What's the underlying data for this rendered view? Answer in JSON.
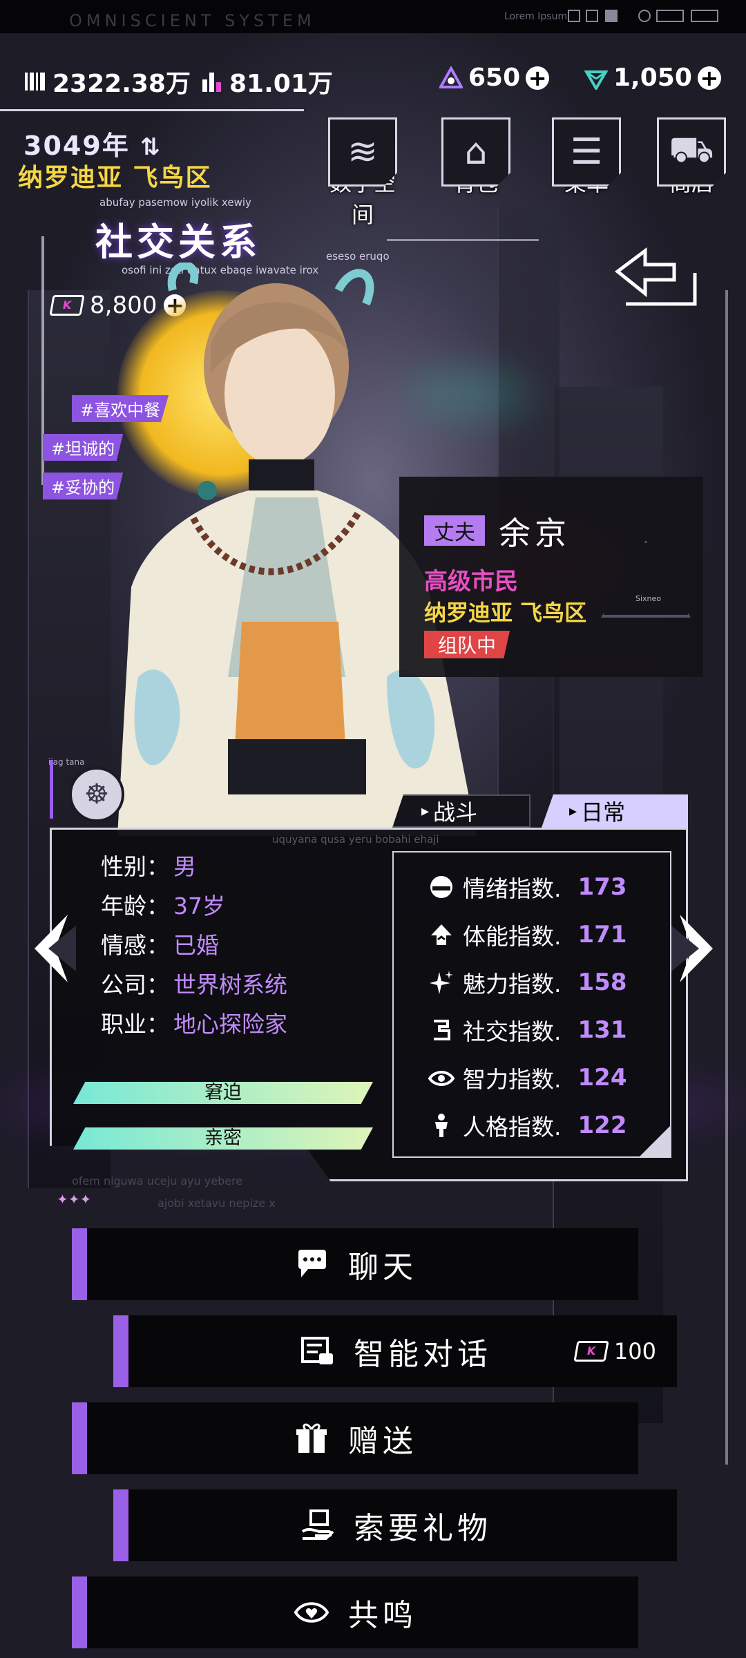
{
  "topbar": {
    "system_title": "OMNISCIENT SYSTEM",
    "lorem": "Lorem Ipsum"
  },
  "resources": {
    "currency1": "2322.38万",
    "currency2": "81.01万",
    "gems": "650",
    "crystals": "1,050"
  },
  "location": {
    "year": "3049年",
    "district": "纳罗迪亚 飞鸟区"
  },
  "top_buttons": [
    {
      "label": "数字空间",
      "icon": "layers-icon"
    },
    {
      "label": "背包",
      "icon": "bag-icon"
    },
    {
      "label": "菜单",
      "icon": "menu-list-icon"
    },
    {
      "label": "商店",
      "icon": "cart-icon"
    }
  ],
  "page": {
    "title": "社交关系",
    "subtitle_top": "abufay pasemow iyolik xewiy",
    "subtitle_bottom": "osofi ini zoti qatux  ebaqe iwavate irox",
    "subtitle_right": "eseso eruqo",
    "coins": "8,800"
  },
  "tags": [
    "#喜欢中餐",
    "#坦诚的",
    "#妥协的"
  ],
  "character": {
    "relation": "丈夫",
    "name": "余京",
    "rank": "高级市民",
    "location": "纳罗迪亚 飞鸟区",
    "status": "组队中",
    "emblem_text": "Sixneo"
  },
  "tabs": {
    "fight": "战斗",
    "daily": "日常"
  },
  "panel_header_text": "uquyana qusa yeru bobahi ehaji",
  "profile": [
    {
      "key": "性别：",
      "value": "男"
    },
    {
      "key": "年龄：",
      "value": "37岁"
    },
    {
      "key": "情感：",
      "value": "已婚"
    },
    {
      "key": "公司：",
      "value": "世界树系统"
    },
    {
      "key": "职业：",
      "value": "地心探险家"
    }
  ],
  "bars": [
    {
      "label": "窘迫",
      "fill": 1.0
    },
    {
      "label": "亲密",
      "fill": 1.0
    }
  ],
  "stats": [
    {
      "label": "情绪指数.",
      "value": "173",
      "icon": "mood-icon"
    },
    {
      "label": "体能指数.",
      "value": "171",
      "icon": "stamina-icon"
    },
    {
      "label": "魅力指数.",
      "value": "158",
      "icon": "sparkle-icon"
    },
    {
      "label": "社交指数.",
      "value": "131",
      "icon": "social-icon"
    },
    {
      "label": "智力指数.",
      "value": "124",
      "icon": "eye-icon"
    },
    {
      "label": "人格指数.",
      "value": "122",
      "icon": "person-icon"
    }
  ],
  "footer_text1": "ofem niguwa uceju ayu yebere",
  "footer_text2": "ajobi xetavu nepize x",
  "avatar_label": "ijag tana",
  "actions": [
    {
      "label": "聊天",
      "icon": "chat-icon"
    },
    {
      "label": "智能对话",
      "icon": "ai-dialog-icon",
      "cost": "100"
    },
    {
      "label": "赠送",
      "icon": "gift-icon"
    },
    {
      "label": "索要礼物",
      "icon": "request-gift-icon"
    },
    {
      "label": "共鸣",
      "icon": "resonance-icon"
    }
  ],
  "colors": {
    "accent": "#9a60e8",
    "value": "#c18bff",
    "gold": "#f5d646",
    "pink": "#ea4ec5",
    "status": "#e04545"
  }
}
